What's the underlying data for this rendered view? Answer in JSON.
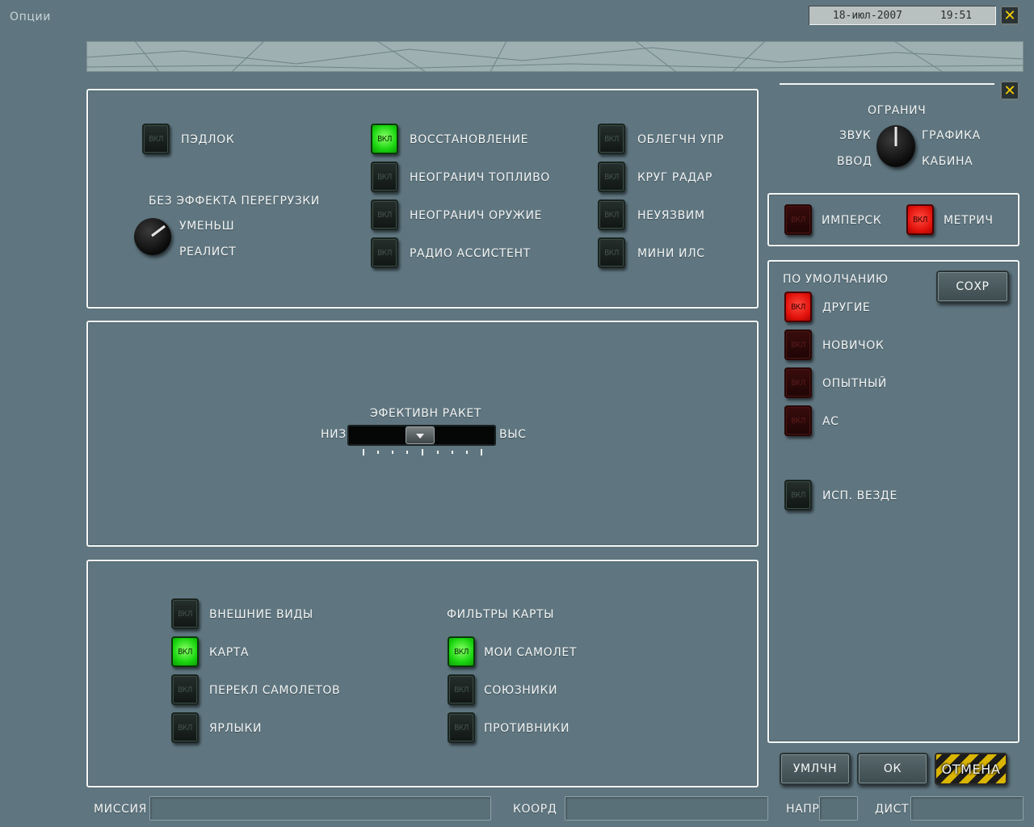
{
  "window": {
    "title": "Опции",
    "datetime": "18-июл-2007      19:51",
    "close_glyph": "✕"
  },
  "flight_panel": {
    "padlock": {
      "state": "ВКЛ",
      "label": "ПЭДЛОК"
    },
    "g_effect_title": "БЕЗ ЭФФЕКТА ПЕРЕГРУЗКИ",
    "g_effect_options": [
      "УМЕНЬШ",
      "РЕАЛИСТ"
    ],
    "col2": [
      {
        "state": "ВКЛ",
        "label": "ВОССТАНОВЛЕНИЕ",
        "on": true
      },
      {
        "state": "ВКЛ",
        "label": "НЕОГРАНИЧ ТОПЛИВО",
        "on": false
      },
      {
        "state": "ВКЛ",
        "label": "НЕОГРАНИЧ ОРУЖИЕ",
        "on": false
      },
      {
        "state": "ВКЛ",
        "label": "РАДИО АССИСТЕНТ",
        "on": false
      }
    ],
    "col3": [
      {
        "state": "ВКЛ",
        "label": "ОБЛЕГЧН УПР",
        "on": false
      },
      {
        "state": "ВКЛ",
        "label": "КРУГ РАДАР",
        "on": false
      },
      {
        "state": "ВКЛ",
        "label": "НЕУЯЗВИМ",
        "on": false
      },
      {
        "state": "ВКЛ",
        "label": "МИНИ ИЛС",
        "on": false
      }
    ]
  },
  "missile_panel": {
    "title": "ЭФЕКТИВН РАКЕТ",
    "low": "НИЗ",
    "high": "ВЫС",
    "level": 0.5
  },
  "view_panel": {
    "left": [
      {
        "state": "ВКЛ",
        "label": "ВНЕШНИЕ ВИДЫ",
        "on": false
      },
      {
        "state": "ВКЛ",
        "label": "КАРТА",
        "on": true
      },
      {
        "state": "ВКЛ",
        "label": "ПЕРЕКЛ САМОЛЕТОВ",
        "on": false
      },
      {
        "state": "ВКЛ",
        "label": "ЯРЛЫКИ",
        "on": false
      }
    ],
    "filters_title": "ФИЛЬТРЫ КАРТЫ",
    "right": [
      {
        "state": "ВКЛ",
        "label": "МОИ САМОЛЕТ",
        "on": true
      },
      {
        "state": "ВКЛ",
        "label": "СОЮЗНИКИ",
        "on": false
      },
      {
        "state": "ВКЛ",
        "label": "ПРОТИВНИКИ",
        "on": false
      }
    ]
  },
  "side": {
    "knob_labels": {
      "top": "ОГРАНИЧ",
      "left_top": "ЗВУК",
      "right_top": "ГРАФИКА",
      "left_bottom": "ВВОД",
      "right_bottom": "КАБИНА"
    },
    "units": [
      {
        "state": "ВКЛ",
        "label": "ИМПЕРСК",
        "on": false
      },
      {
        "state": "ВКЛ",
        "label": "МЕТРИЧ",
        "on": true
      }
    ],
    "defaults_title": "ПО УМОЛЧАНИЮ",
    "save_label": "СОХР",
    "presets": [
      {
        "state": "ВКЛ",
        "label": "ДРУГИЕ",
        "on": true
      },
      {
        "state": "ВКЛ",
        "label": "НОВИЧОК",
        "on": false
      },
      {
        "state": "ВКЛ",
        "label": "ОПЫТНЫЙ",
        "on": false
      },
      {
        "state": "ВКЛ",
        "label": "АС",
        "on": false
      }
    ],
    "use_everywhere": {
      "state": "ВКЛ",
      "label": "ИСП. ВЕЗДЕ",
      "on": false
    }
  },
  "buttons": {
    "default": "УМЛЧН",
    "ok": "ОК",
    "cancel": "ОТМЕНА"
  },
  "status_bar": {
    "mission": "МИССИЯ",
    "coord": "КООРД",
    "heading": "НАПР",
    "distance": "ДИСТ"
  }
}
